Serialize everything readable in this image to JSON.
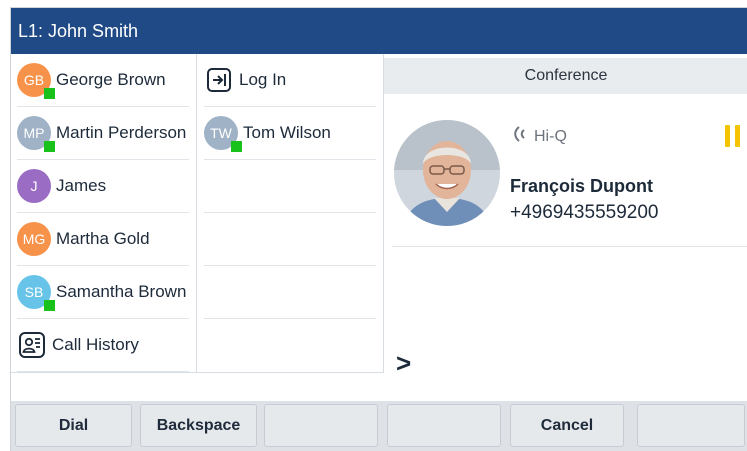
{
  "header": {
    "title": "L1: John Smith"
  },
  "contacts_col1": [
    {
      "initials": "GB",
      "name": "George Brown",
      "color": "#f7924a",
      "presence": true
    },
    {
      "initials": "MP",
      "name": "Martin Perderson",
      "color": "#9fb2c6",
      "presence": true
    },
    {
      "initials": "J",
      "name": "James",
      "color": "#9b6cc4",
      "presence": false
    },
    {
      "initials": "MG",
      "name": "Martha Gold",
      "color": "#f7924a",
      "presence": false
    },
    {
      "initials": "SB",
      "name": "Samantha Brown",
      "color": "#67c4e8",
      "presence": true
    }
  ],
  "call_history": {
    "label": "Call History",
    "icon": "call-history-icon"
  },
  "col2": {
    "login": {
      "label": "Log In",
      "icon": "login-icon"
    },
    "contact": {
      "initials": "TW",
      "name": "Tom Wilson",
      "color": "#9fb2c6",
      "presence": true
    }
  },
  "call": {
    "header": "Conference",
    "codec": "Hi-Q",
    "caller_name": "François Dupont",
    "caller_number": "+4969435559200",
    "prompt": ">",
    "status_color": "#f5c300"
  },
  "softkeys": [
    "Dial",
    "Backspace",
    "",
    "",
    "Cancel",
    ""
  ],
  "colors": {
    "titlebar": "#1f4a86",
    "presence": "#19c21a"
  }
}
